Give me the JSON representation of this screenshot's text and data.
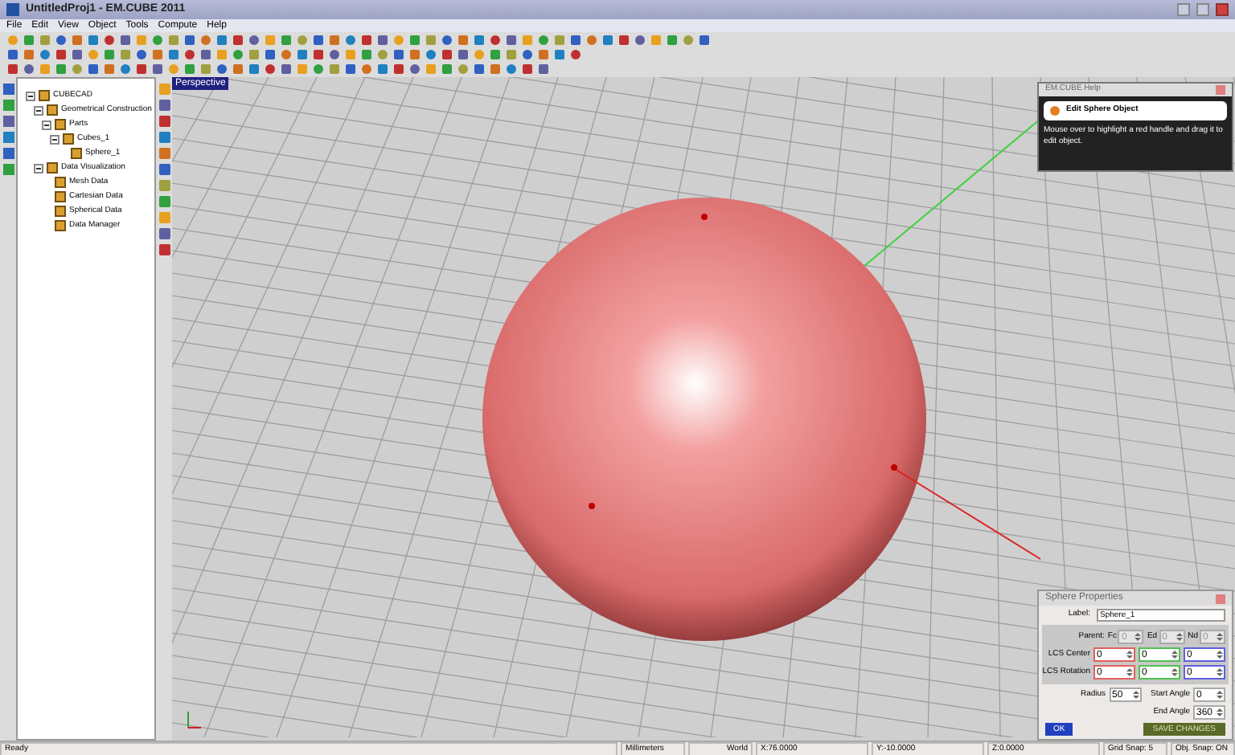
{
  "window": {
    "title": "UntitledProj1 - EM.CUBE 2011"
  },
  "menu": [
    "File",
    "Edit",
    "View",
    "Object",
    "Tools",
    "Compute",
    "Help"
  ],
  "tree": [
    {
      "label": "CUBECAD",
      "expanded": true,
      "children": [
        {
          "label": "Geometrical Construction",
          "expanded": true,
          "children": [
            {
              "label": "Parts",
              "expanded": true,
              "children": [
                {
                  "label": "Cubes_1",
                  "expanded": true,
                  "children": [
                    {
                      "label": "Sphere_1"
                    }
                  ]
                }
              ]
            }
          ]
        },
        {
          "label": "Data Visualization",
          "expanded": true,
          "children": [
            {
              "label": "Mesh Data"
            },
            {
              "label": "Cartesian Data"
            },
            {
              "label": "Spherical Data"
            },
            {
              "label": "Data Manager"
            }
          ]
        }
      ]
    }
  ],
  "viewport": {
    "label": "Perspective"
  },
  "help": {
    "title": "EM.CUBE Help",
    "heading": "Edit Sphere Object",
    "body": "Mouse over to highlight a red handle and drag it to edit object."
  },
  "properties": {
    "title": "Sphere Properties",
    "label_caption": "Label:",
    "label_value": "Sphere_1",
    "parent_caption": "Parent:",
    "parent": [
      {
        "caption": "Fc",
        "value": "0",
        "disabled": true
      },
      {
        "caption": "Ed",
        "value": "0",
        "disabled": true
      },
      {
        "caption": "Nd",
        "value": "0",
        "disabled": true
      }
    ],
    "rows": [
      {
        "caption": "LCS Center",
        "values": [
          "0",
          "0",
          "0"
        ]
      },
      {
        "caption": "LCS Rotation",
        "values": [
          "0",
          "0",
          "0"
        ]
      }
    ],
    "radius": {
      "caption": "Radius",
      "value": "50"
    },
    "start_angle": {
      "caption": "Start Angle",
      "value": "0"
    },
    "end_angle": {
      "caption": "End Angle",
      "value": "360"
    },
    "ok": "OK",
    "save": "SAVE CHANGES"
  },
  "status_bar": [
    "Ready",
    "Millimeters",
    "World",
    "X:76.0000",
    "Y:-10.0000",
    "Z:0.0000",
    "Grid Snap: 5",
    "Obj. Snap: ON"
  ]
}
